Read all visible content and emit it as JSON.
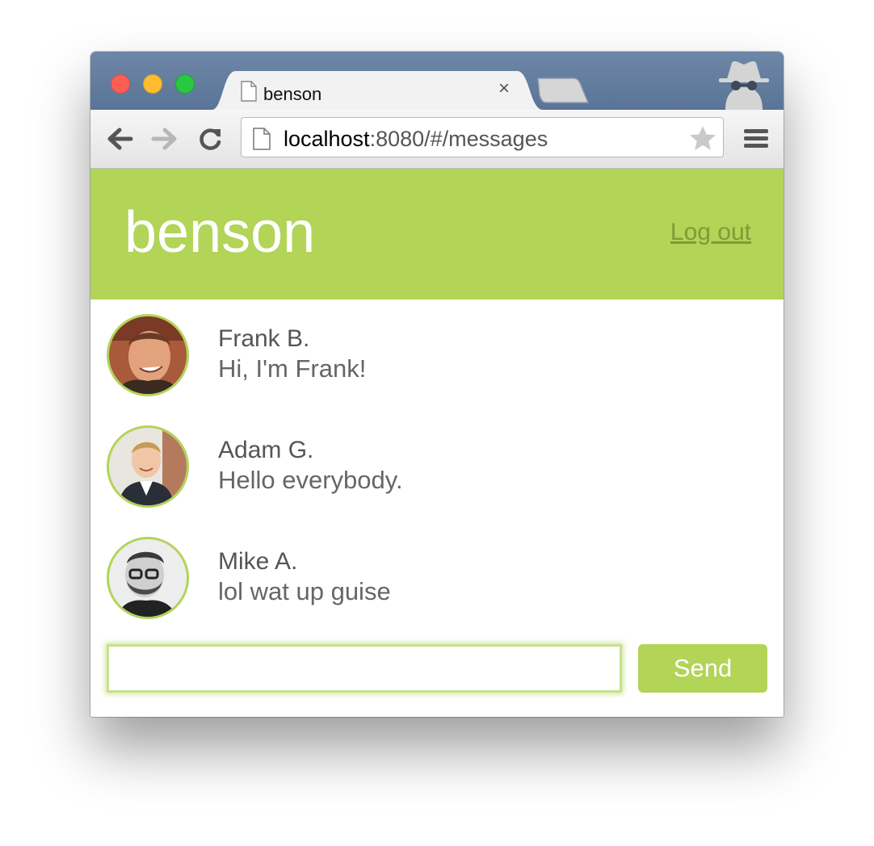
{
  "browser": {
    "tab_title": "benson",
    "tab_close": "×",
    "url_host": "localhost",
    "url_path": ":8080/#/messages",
    "icons": [
      "back-icon",
      "forward-icon",
      "reload-icon",
      "page-icon",
      "bookmark-star-icon",
      "menu-icon",
      "incognito-icon",
      "close-icon"
    ]
  },
  "app": {
    "title": "benson",
    "logout_label": "Log out",
    "accent_color": "#b2d457",
    "messages": [
      {
        "name": "Frank B.",
        "text": "Hi, I'm Frank!"
      },
      {
        "name": "Adam G.",
        "text": "Hello everybody."
      },
      {
        "name": "Mike A.",
        "text": "lol wat up guise"
      }
    ],
    "compose": {
      "value": "",
      "send_label": "Send"
    }
  }
}
